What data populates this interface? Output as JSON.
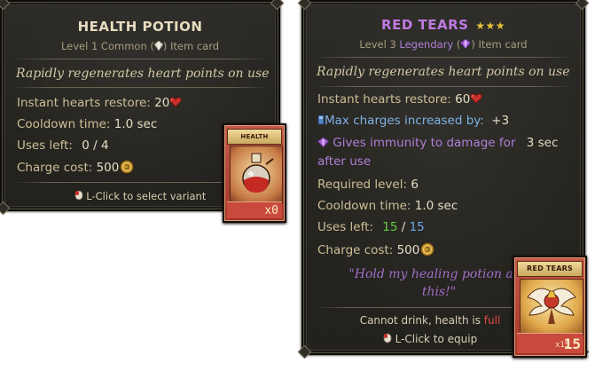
{
  "left_card": {
    "title": "HEALTH POTION",
    "subtitle_pre": "Level 1 Common (",
    "subtitle_post": ") Item card",
    "description": "Rapidly regenerates heart points on use",
    "stats": {
      "restore_label": "Instant hearts restore:",
      "restore_value": "20",
      "cooldown_label": "Cooldown time:",
      "cooldown_value": "1.0 sec",
      "uses_label": "Uses left:",
      "uses_value": "0 / 4",
      "charge_label": "Charge cost:",
      "charge_value": "500"
    },
    "hint_text": "L-Click to select variant",
    "card_art": {
      "banner": "HEALTH POTION",
      "count": "x0"
    },
    "colors": {
      "title": "#e7dcbf",
      "frame": "#b83a2a"
    },
    "icons": [
      "heart-icon",
      "coin-icon",
      "gem-icon",
      "mouse-icon",
      "potion-icon"
    ]
  },
  "right_card": {
    "title": "RED TEARS",
    "stars": "★★★",
    "subtitle_pre": "Level 3 ",
    "rarity": "Legendary",
    "subtitle_mid": " (",
    "subtitle_post": ") Item card",
    "description": "Rapidly regenerates heart points on use",
    "stats": {
      "restore_label": "Instant hearts restore:",
      "restore_value": "60",
      "charges_label": "Max charges increased by:",
      "charges_value": "+3",
      "immunity_label": "Gives immunity to damage for",
      "immunity_value": "3 sec",
      "immunity_cont": "after use",
      "required_label": "Required level:",
      "required_value": "6",
      "cooldown_label": "Cooldown time:",
      "cooldown_value": "1.0 sec",
      "uses_label": "Uses left:",
      "uses_current": "15",
      "uses_sep": " / ",
      "uses_max": "15",
      "charge_label": "Charge cost:",
      "charge_value": "500"
    },
    "quote_line1": "\"Hold my healing potion and",
    "quote_line2": "this!\"",
    "warning_pre": "Cannot drink, health is ",
    "warning_state": "full",
    "hint_text": "L-Click to equip",
    "card_art": {
      "banner": "RED TEARS",
      "count": "15",
      "small_count": "x15"
    },
    "colors": {
      "title": "#c07ae0",
      "stars": "#e8c13a",
      "frame": "#b83a2a"
    },
    "icons": [
      "heart-icon",
      "coin-icon",
      "gem-icon",
      "mouse-icon",
      "charge-icon",
      "winged-relic-icon"
    ]
  }
}
